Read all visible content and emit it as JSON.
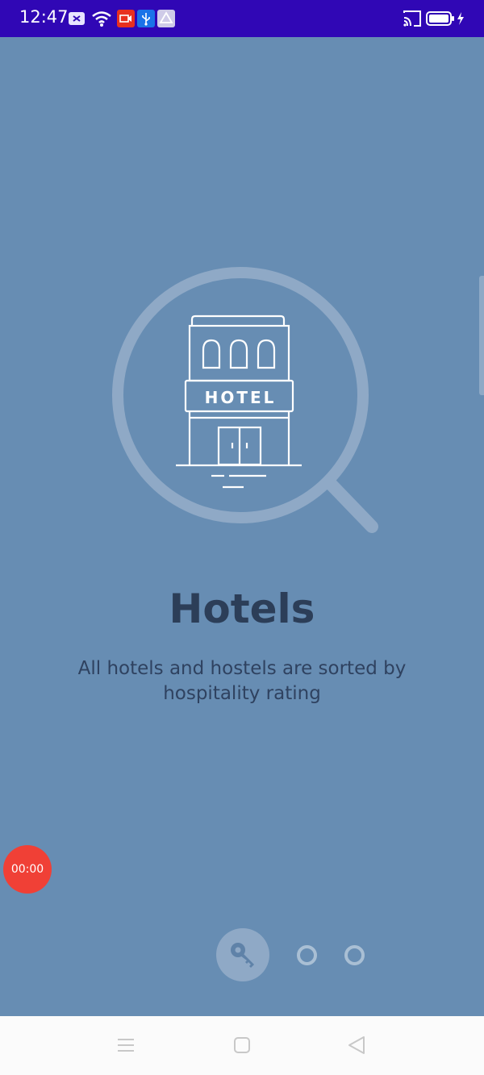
{
  "status_bar": {
    "time": "12:47",
    "icons": [
      "notification-icon",
      "wifi-icon",
      "screen-record-icon",
      "usb-icon",
      "drive-icon"
    ],
    "right_icons": [
      "cast-icon",
      "battery-icon",
      "charging-icon"
    ]
  },
  "onboarding": {
    "illustration_label": "HOTEL",
    "title": "Hotels",
    "description": "All hotels and hostels are sorted by hospitality rating"
  },
  "timer": {
    "value": "00:00"
  },
  "pager": {
    "active_icon": "key-icon",
    "page_count": 3,
    "active_index": 0
  },
  "nav_bar": {
    "buttons": [
      "menu-icon",
      "home-icon",
      "back-icon"
    ]
  },
  "colors": {
    "background": "#678db3",
    "status_bar": "#3007b5",
    "title_text": "#2c3e58",
    "timer": "#f04036"
  }
}
